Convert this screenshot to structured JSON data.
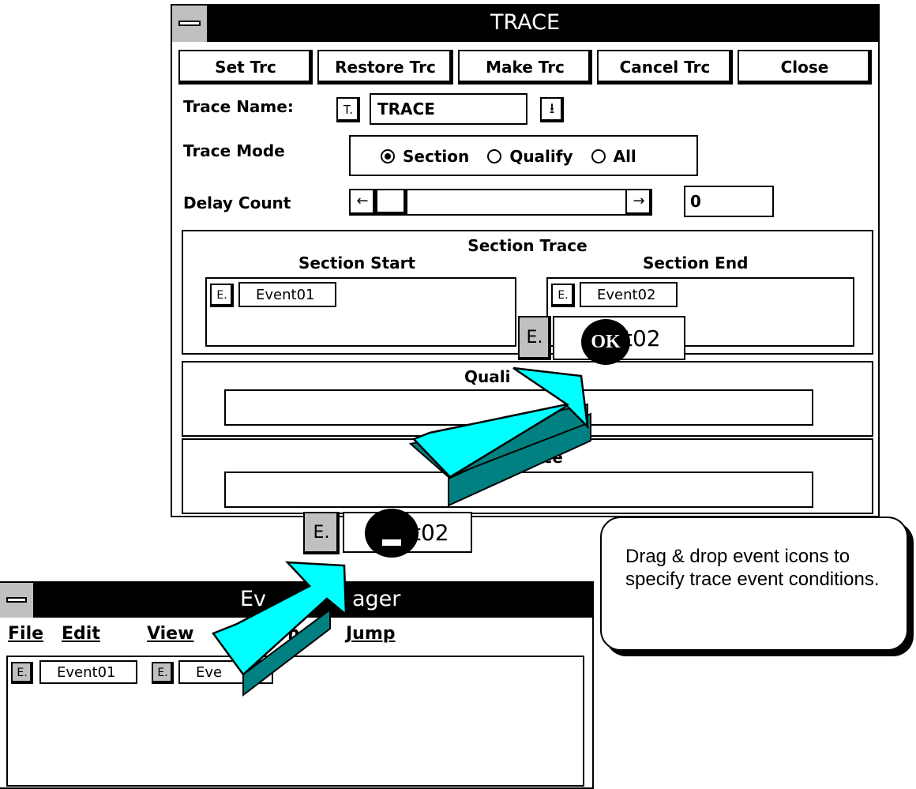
{
  "trace_window": {
    "title": "TRACE",
    "buttons": [
      "Set Trc",
      "Restore Trc",
      "Make Trc",
      "Cancel Trc",
      "Close"
    ],
    "trace_name_label": "Trace Name:",
    "trace_name_icon": "T.",
    "trace_name_value": "TRACE",
    "trace_mode_label": "Trace Mode",
    "trace_mode_options": [
      "Section",
      "Qualify",
      "All"
    ],
    "trace_mode_selected": "Section",
    "delay_count_label": "Delay Count",
    "delay_count_value": "0",
    "section_trace_title": "Section Trace",
    "section_start_label": "Section Start",
    "section_end_label": "Section End",
    "section_start_event": "Event01",
    "section_end_event": "Event02",
    "qualify_title_partial": "Quali",
    "trace_title_partial": "race"
  },
  "drag": {
    "icon_label": "E.",
    "top_drop_partial": "t02",
    "bottom_drag_partial": "t02",
    "ok_badge": "OK"
  },
  "event_manager": {
    "title_left": "Ev",
    "title_right": "ager",
    "menus": [
      "File",
      "Edit",
      "View",
      "n",
      "Jump"
    ],
    "events": [
      {
        "icon": "E.",
        "name": "Event01"
      },
      {
        "icon": "E.",
        "name": "Eve"
      }
    ]
  },
  "callout": {
    "text": "Drag & drop event icons to specify trace event conditions."
  },
  "colors": {
    "arrow_face": "#00ffff",
    "arrow_side": "#008080",
    "title_bar": "#000000",
    "icon_gray": "#c0c0c0"
  }
}
